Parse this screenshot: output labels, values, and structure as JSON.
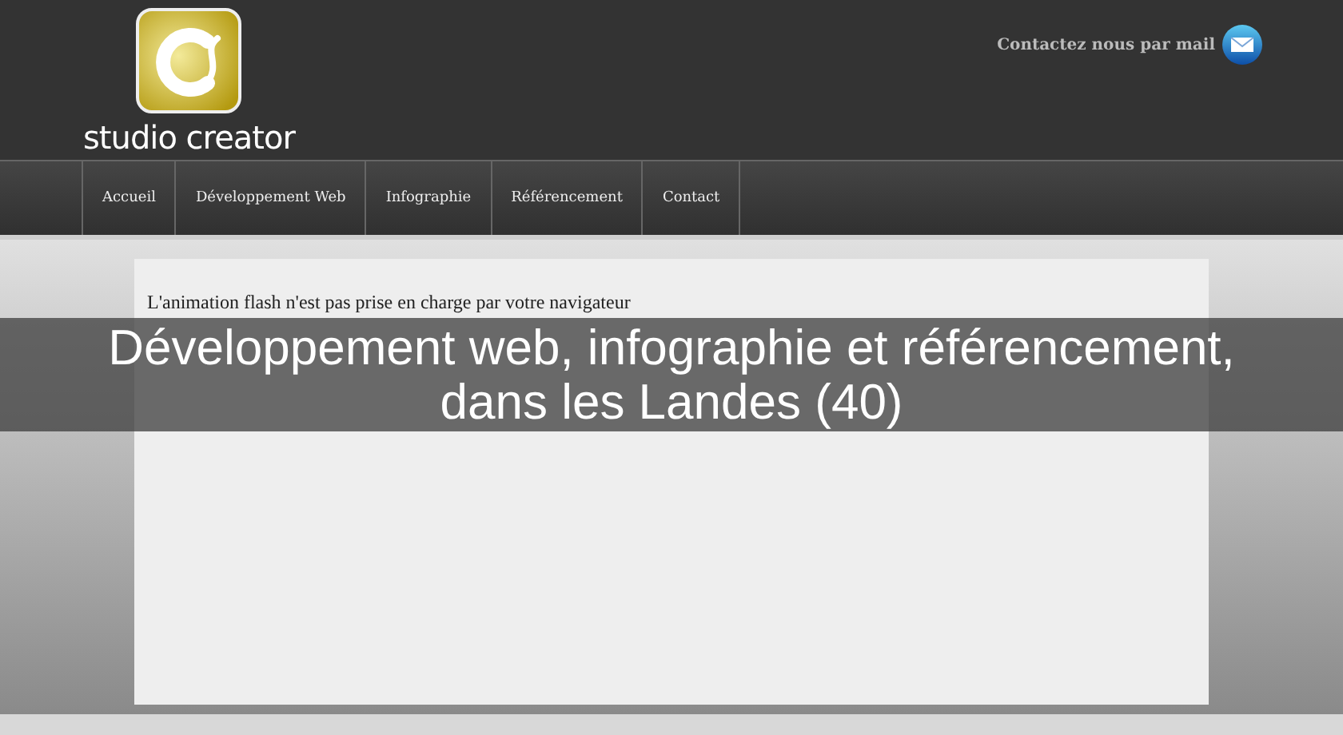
{
  "header": {
    "brand": "studio creator",
    "contact_link": "Contactez nous par mail"
  },
  "nav": {
    "items": [
      {
        "label": "Accueil"
      },
      {
        "label": "Développement Web"
      },
      {
        "label": "Infographie"
      },
      {
        "label": "Référencement"
      },
      {
        "label": "Contact"
      }
    ]
  },
  "content": {
    "flash_notice": "L'animation flash n'est pas prise en charge par votre navigateur"
  },
  "caption": {
    "lines": [
      "Développement web, infographie et référencement,",
      "dans les Landes (40)"
    ]
  }
}
